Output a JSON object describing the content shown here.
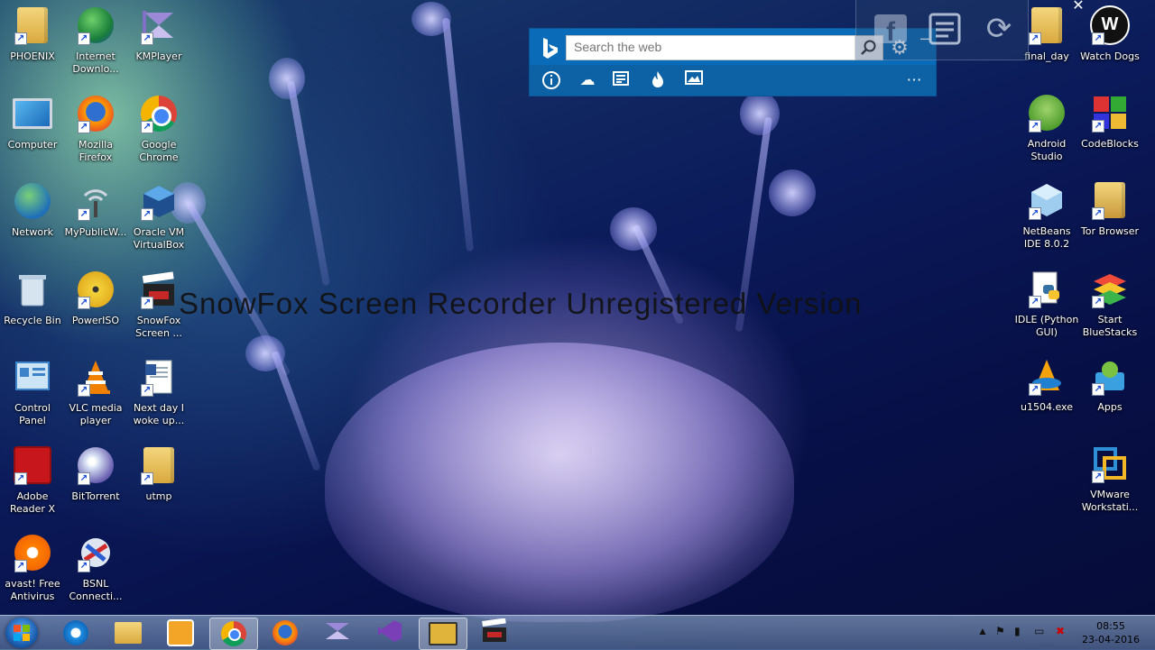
{
  "desktop": {
    "left_icons": [
      {
        "name": "PHOENIX",
        "icon": "user-folder-icon"
      },
      {
        "name": "Internet Downlo...",
        "icon": "idm-icon"
      },
      {
        "name": "KMPlayer",
        "icon": "kmplayer-icon"
      },
      {
        "name": "Computer",
        "icon": "computer-icon"
      },
      {
        "name": "Mozilla Firefox",
        "icon": "firefox-icon"
      },
      {
        "name": "Google Chrome",
        "icon": "chrome-icon"
      },
      {
        "name": "Network",
        "icon": "network-icon"
      },
      {
        "name": "MyPublicW...",
        "icon": "wifi-hotspot-icon"
      },
      {
        "name": "Oracle VM VirtualBox",
        "icon": "virtualbox-icon"
      },
      {
        "name": "Recycle Bin",
        "icon": "recycle-bin-icon"
      },
      {
        "name": "PowerISO",
        "icon": "poweriso-icon"
      },
      {
        "name": "SnowFox Screen ...",
        "icon": "clapperboard-icon"
      },
      {
        "name": "Control Panel",
        "icon": "control-panel-icon"
      },
      {
        "name": "VLC media player",
        "icon": "vlc-icon"
      },
      {
        "name": "Next day I woke up...",
        "icon": "document-icon"
      },
      {
        "name": "Adobe Reader X",
        "icon": "adobe-reader-icon"
      },
      {
        "name": "BitTorrent",
        "icon": "bittorrent-icon"
      },
      {
        "name": "utmp",
        "icon": "folder-icon"
      },
      {
        "name": "avast! Free Antivirus",
        "icon": "avast-icon"
      },
      {
        "name": "BSNL Connecti...",
        "icon": "bsnl-icon"
      }
    ],
    "right_icons": [
      {
        "name": "final_day",
        "icon": "folder-icon"
      },
      {
        "name": "Watch Dogs",
        "icon": "watchdogs-icon"
      },
      {
        "name": "Android Studio",
        "icon": "android-studio-icon"
      },
      {
        "name": "CodeBlocks",
        "icon": "codeblocks-icon"
      },
      {
        "name": "NetBeans IDE 8.0.2",
        "icon": "netbeans-icon"
      },
      {
        "name": "Tor Browser",
        "icon": "tor-folder-icon"
      },
      {
        "name": "IDLE (Python GUI)",
        "icon": "python-idle-icon"
      },
      {
        "name": "Start BlueStacks",
        "icon": "bluestacks-icon"
      },
      {
        "name": "u1504.exe",
        "icon": "u1504-icon"
      },
      {
        "name": "Apps",
        "icon": "apps-icon"
      },
      {
        "name": "VMware Workstati...",
        "icon": "vmware-icon"
      }
    ]
  },
  "watermark": "SnowFox Screen Recorder Unregistered Version",
  "bing": {
    "placeholder": "Search the web",
    "toolbar": [
      "info-icon",
      "weather-icon",
      "news-icon",
      "trending-icon",
      "images-icon",
      "more-icon"
    ]
  },
  "taskbar": {
    "pinned": [
      "internet-explorer-icon",
      "file-explorer-icon",
      "media-player-icon",
      "chrome-icon",
      "firefox-icon",
      "visual-studio-icon",
      "visual-studio-purple-icon",
      "bing-desktop-icon",
      "snowfox-icon"
    ],
    "active": "bing-desktop-icon",
    "time": "08:55",
    "date": "23-04-2016"
  },
  "colors": {
    "bing_blue": "#0a6cb8",
    "taskbar": "#8fb0d4"
  }
}
